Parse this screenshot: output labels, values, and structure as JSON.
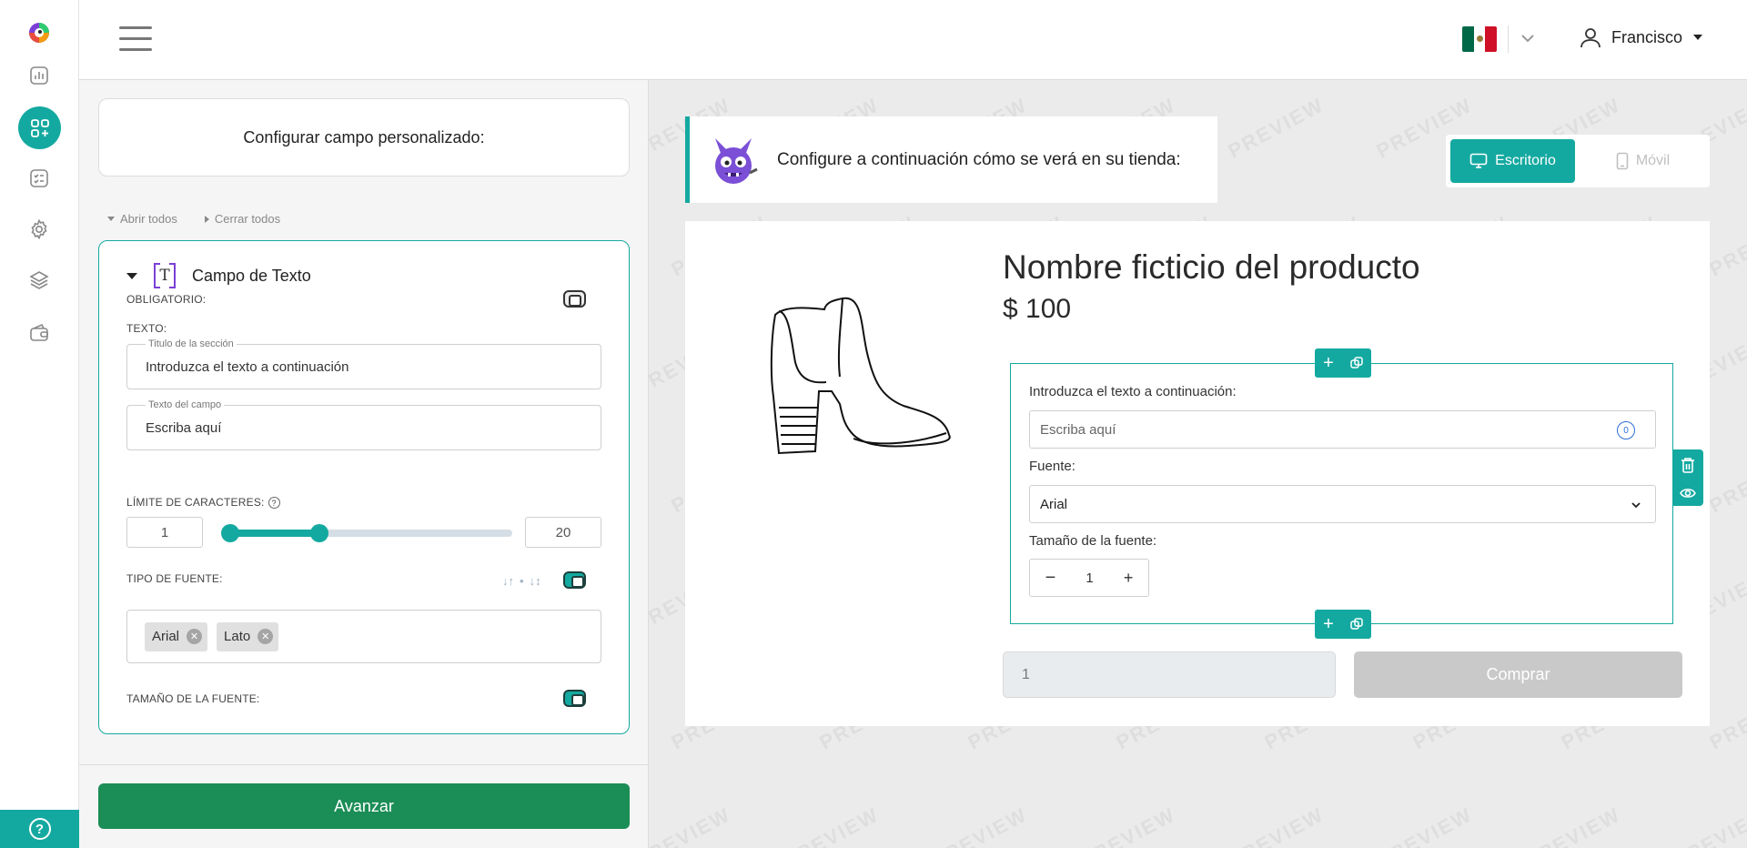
{
  "user": {
    "name": "Francisco"
  },
  "panel": {
    "title": "Configurar campo personalizado:",
    "open_all": "Abrir todos",
    "close_all": "Cerrar todos",
    "card_title": "Campo de Texto",
    "required_label": "OBLIGATORIO:",
    "text_label": "TEXTO:",
    "section_title_legend": "Titulo de la sección",
    "section_title_value": "Introduzca el texto a continuación",
    "field_text_legend": "Texto del campo",
    "field_text_value": "Escriba aquí",
    "char_limit_label": "LÍMITE DE CARACTERES:",
    "char_min": "1",
    "char_max": "20",
    "char_slider": {
      "min": 1,
      "max": 20,
      "low": 1,
      "high": 7
    },
    "font_type_label": "TIPO DE FUENTE:",
    "font_chips": [
      "Arial",
      "Lato"
    ],
    "font_size_label": "TAMAÑO DE LA FUENTE:",
    "toggles": {
      "required": false,
      "font_type": true,
      "font_size": true
    },
    "next_button": "Avanzar"
  },
  "preview": {
    "banner_text": "Configure a continuación cómo se verá en su tienda:",
    "desktop_label": "Escritorio",
    "mobile_label": "Móvil",
    "watermark": "PREVIEW",
    "product_name": "Nombre ficticio del producto",
    "product_price": "$ 100",
    "field_label": "Introduzca el texto a continuación:",
    "field_placeholder": "Escriba aquí",
    "char_counter": "0",
    "font_label": "Fuente:",
    "font_value": "Arial",
    "size_label": "Tamaño de la fuente:",
    "size_value": "1",
    "qty_value": "1",
    "buy_button": "Comprar"
  },
  "colors": {
    "accent": "#14a9a0",
    "primary_button": "#1b8d56",
    "disabled": "#c9c9c9"
  }
}
